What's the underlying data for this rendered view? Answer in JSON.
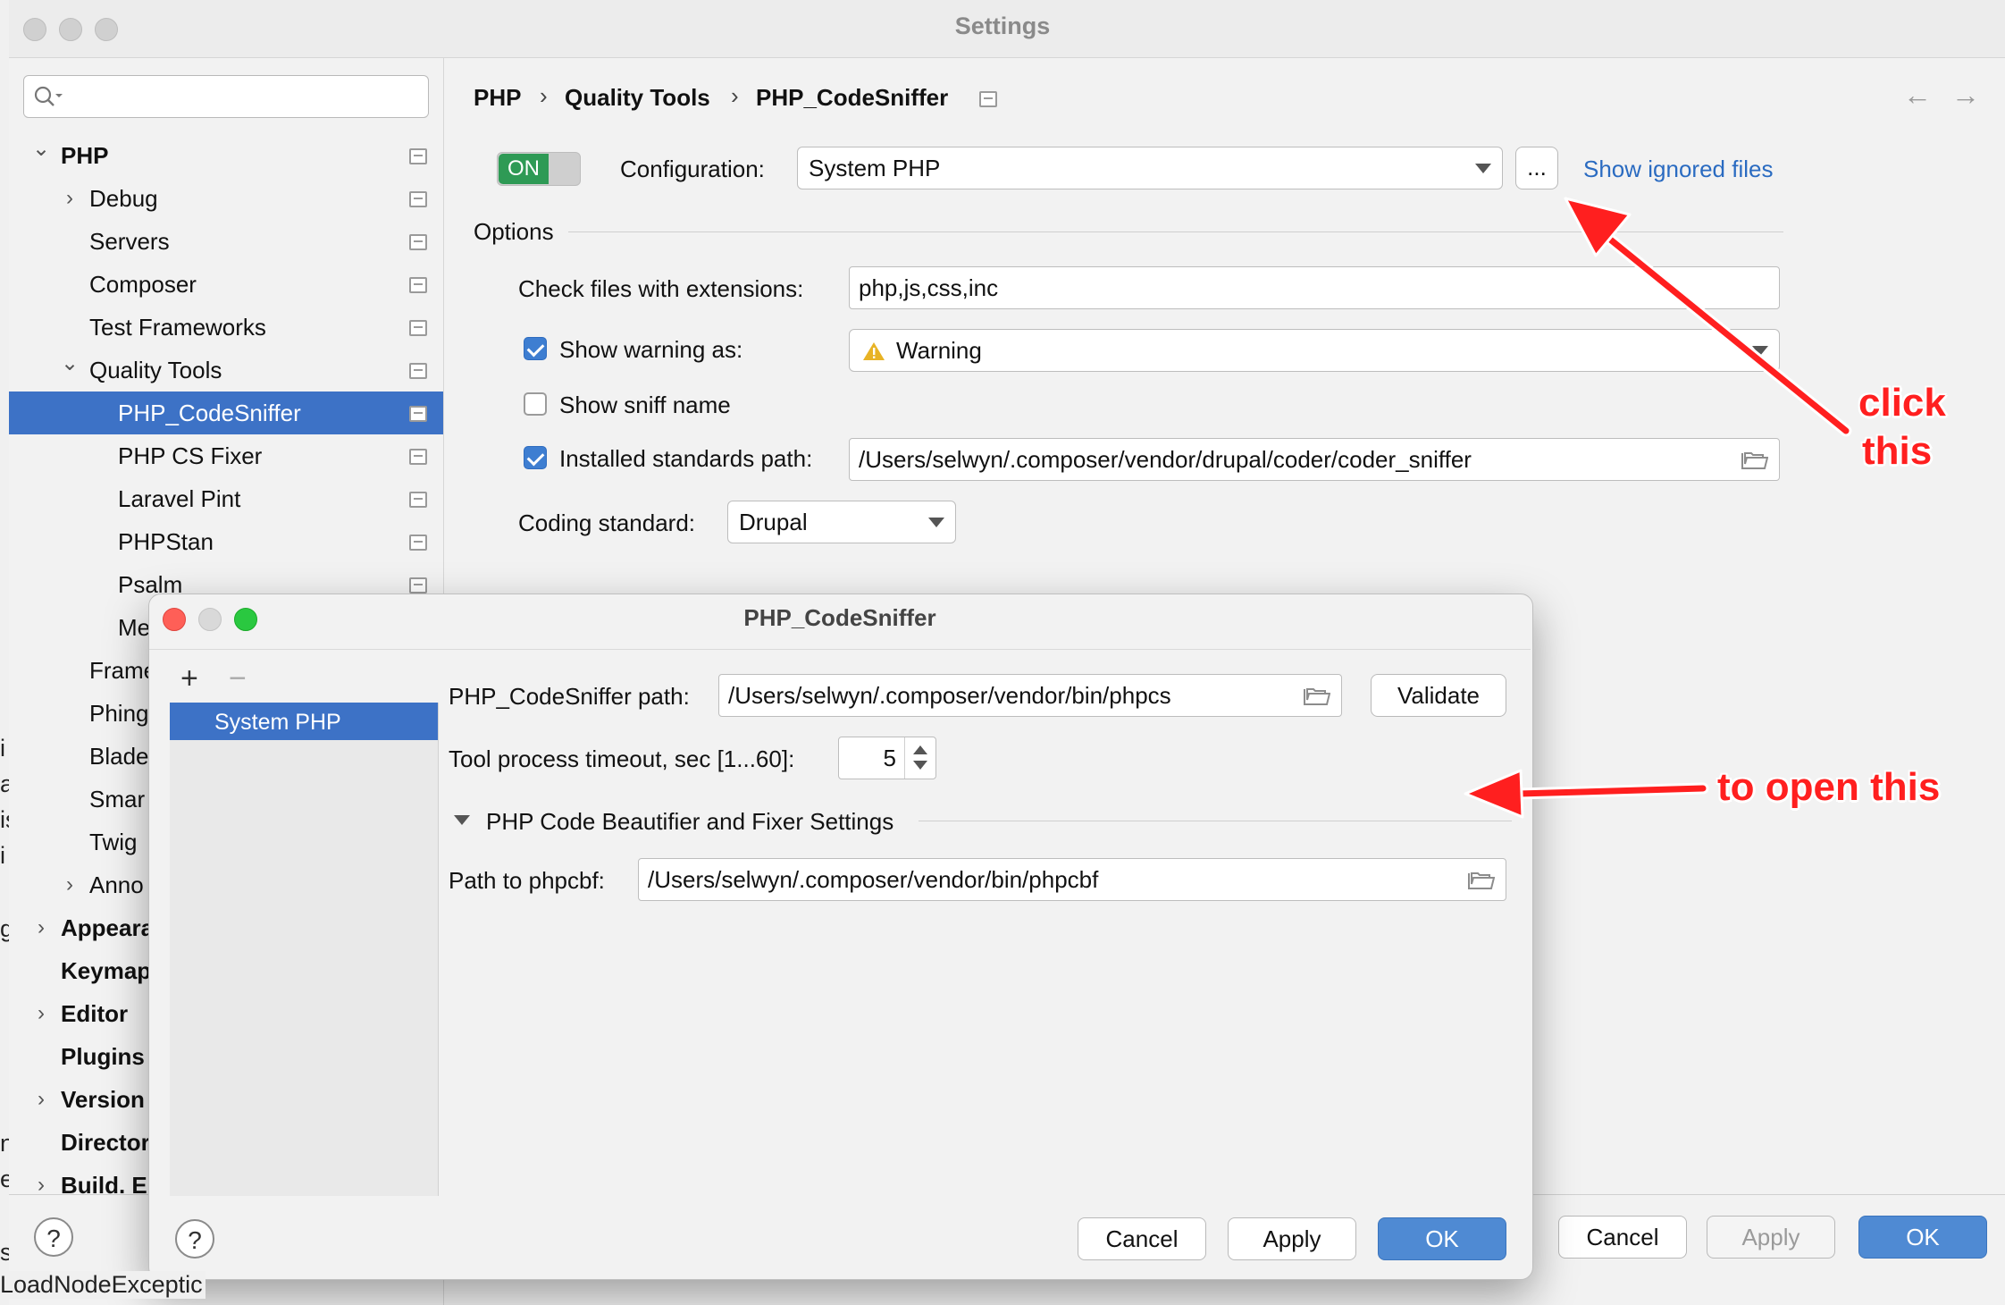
{
  "window": {
    "title": "Settings"
  },
  "background": {
    "fragments": [
      "i",
      "a",
      "is",
      "i",
      "g",
      "n",
      "e",
      "s"
    ],
    "bottom_text": "LoadNodeExceptic"
  },
  "sidebar": {
    "search_placeholder": "",
    "items": [
      {
        "label": "PHP",
        "bold": true,
        "arrow": "⌄"
      },
      {
        "label": "Debug",
        "arrow": "›"
      },
      {
        "label": "Servers"
      },
      {
        "label": "Composer"
      },
      {
        "label": "Test Frameworks"
      },
      {
        "label": "Quality Tools",
        "arrow": "⌄"
      },
      {
        "label": "PHP_CodeSniffer",
        "selected": true
      },
      {
        "label": "PHP CS Fixer"
      },
      {
        "label": "Laravel Pint"
      },
      {
        "label": "PHPStan"
      },
      {
        "label": "Psalm"
      },
      {
        "label": "Me"
      },
      {
        "label": "Frame"
      },
      {
        "label": "Phing"
      },
      {
        "label": "Blade"
      },
      {
        "label": "Smar"
      },
      {
        "label": "Twig"
      },
      {
        "label": "Anno",
        "arrow": "›"
      },
      {
        "label": "Appeara",
        "bold": true,
        "arrow": "›"
      },
      {
        "label": "Keymap",
        "bold": true
      },
      {
        "label": "Editor",
        "bold": true,
        "arrow": "›"
      },
      {
        "label": "Plugins",
        "bold": true
      },
      {
        "label": "Version",
        "bold": true,
        "arrow": "›"
      },
      {
        "label": "Director",
        "bold": true
      },
      {
        "label": "Build. E",
        "bold": true,
        "arrow": "›"
      }
    ]
  },
  "breadcrumb": {
    "items": [
      "PHP",
      "Quality Tools",
      "PHP_CodeSniffer"
    ],
    "separator": "›"
  },
  "nav": {
    "back": "←",
    "forward": "→"
  },
  "panel": {
    "toggle_label": "ON",
    "configuration_label": "Configuration:",
    "configuration_value": "System PHP",
    "ellipsis_label": "...",
    "show_ignored_label": "Show ignored files",
    "options_label": "Options",
    "check_ext_label": "Check files with extensions:",
    "check_ext_value": "php,js,css,inc",
    "show_warning_label": "Show warning as:",
    "show_warning_checked": true,
    "warning_value": "Warning",
    "show_sniff_label": "Show sniff name",
    "show_sniff_checked": false,
    "installed_path_label": "Installed standards path:",
    "installed_path_checked": true,
    "installed_path_value": "/Users/selwyn/.composer/vendor/drupal/coder/coder_sniffer",
    "coding_standard_label": "Coding standard:",
    "coding_standard_value": "Drupal"
  },
  "footer": {
    "help": "?",
    "cancel": "Cancel",
    "apply": "Apply",
    "ok": "OK"
  },
  "dialog": {
    "title": "PHP_CodeSniffer",
    "add": "+",
    "remove": "−",
    "interpreters": [
      "System PHP"
    ],
    "path_label": "PHP_CodeSniffer path:",
    "path_value": "/Users/selwyn/.composer/vendor/bin/phpcs",
    "validate_label": "Validate",
    "timeout_label": "Tool process timeout, sec [1...60]:",
    "timeout_value": "5",
    "section_label": "PHP Code Beautifier and Fixer Settings",
    "phpcbf_label": "Path to phpcbf:",
    "phpcbf_value": "/Users/selwyn/.composer/vendor/bin/phpcbf",
    "help": "?",
    "cancel": "Cancel",
    "apply": "Apply",
    "ok": "OK"
  },
  "annotations": {
    "click_line1": "click",
    "click_line2": "this",
    "open_text": "to open this",
    "color": "#ff1f1f"
  },
  "colors": {
    "accent": "#3d72c6",
    "toggle_on": "#2e9a55",
    "primary_button": "#4f8ad3",
    "link": "#2a6bc1"
  }
}
